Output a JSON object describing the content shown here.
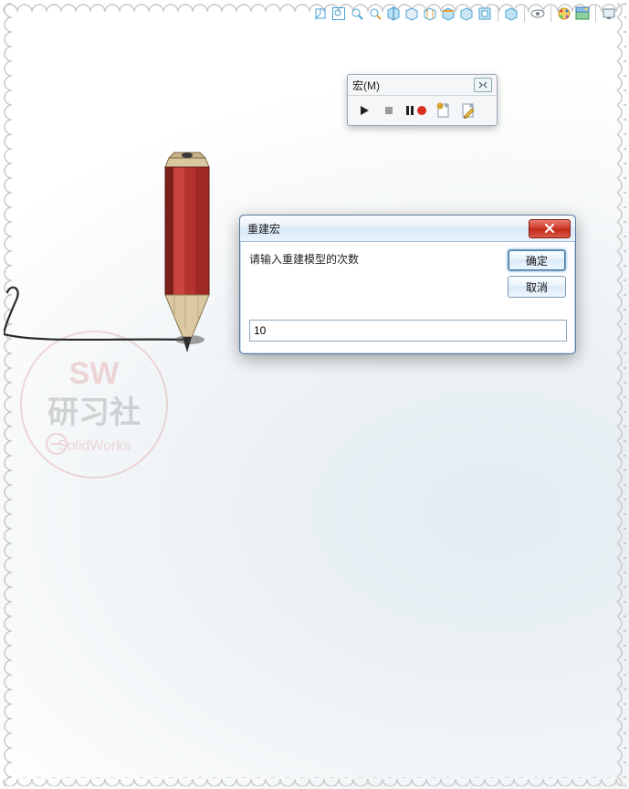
{
  "macro_toolbar": {
    "title": "宏(M)",
    "buttons": {
      "play": "play-icon",
      "stop": "stop-icon",
      "pause_record": "pause-record-icon",
      "new_macro": "new-macro-icon",
      "edit_macro": "edit-macro-icon"
    }
  },
  "dialog": {
    "title": "重建宏",
    "prompt": "请输入重建模型的次数",
    "ok_label": "确定",
    "cancel_label": "取消",
    "input_value": "10"
  },
  "top_toolbar": {
    "items": [
      "view-orientation-icon",
      "zoom-window-icon",
      "zoom-fit-icon",
      "zoom-previous-icon",
      "section-view-icon",
      "display-style-icon",
      "hlr-style-icon",
      "draft-analysis-icon",
      "model-display-icon",
      "model-display2-icon",
      "sep",
      "model-display3-icon",
      "sep",
      "visibility-icon",
      "sep",
      "appearance-icon",
      "scene-icon",
      "sep",
      "render-settings-icon"
    ]
  },
  "watermark": {
    "line1": "SW",
    "line2": "研习社",
    "line3": "SolidWorks"
  }
}
